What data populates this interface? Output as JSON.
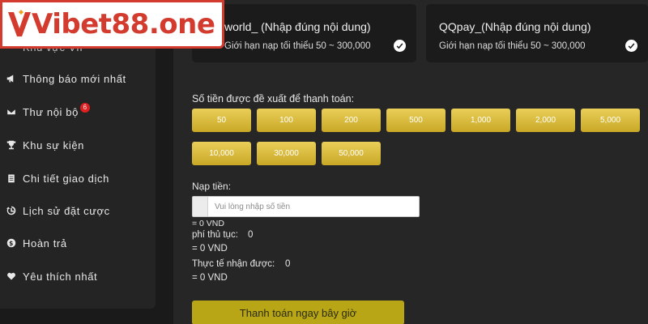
{
  "logo": {
    "text": "Vibet88.one"
  },
  "sidebar": {
    "partial_item": "Khu vực VIP",
    "items": [
      {
        "label": "Thông báo mới nhất",
        "icon": "megaphone-icon"
      },
      {
        "label": "Thư nội bộ",
        "icon": "envelope-icon",
        "badge": "6"
      },
      {
        "label": "Khu sự kiện",
        "icon": "trophy-icon"
      },
      {
        "label": "Chi tiết giao dịch",
        "icon": "clipboard-icon"
      },
      {
        "label": "Lịch sử đặt cược",
        "icon": "history-icon"
      },
      {
        "label": "Hoàn trả",
        "icon": "dollar-icon"
      },
      {
        "label": "Yêu thích nhất",
        "icon": "heart-icon"
      }
    ]
  },
  "payment_methods": [
    {
      "title": "world_  (Nhập đúng nội dung)",
      "limit": "Giới hạn nạp tối thiểu 50 ~ 300,000",
      "selected": true
    },
    {
      "title": "QQpay_(Nhập đúng nội dung)",
      "limit": "Giới hạn nạp tối thiểu 50 ~ 300,000",
      "selected": true
    }
  ],
  "suggested": {
    "label": "Số tiền được đề xuất để thanh toán:",
    "amounts": [
      "50",
      "100",
      "200",
      "500",
      "1,000",
      "2,000",
      "5,000",
      "10,000",
      "30,000",
      "50,000"
    ]
  },
  "deposit": {
    "label": "Nạp tiền:",
    "placeholder": "Vui lòng nhập số tiền",
    "converted": "= 0 VND"
  },
  "fee": {
    "label": "phí thủ tục:",
    "value": "0",
    "converted": "= 0 VND"
  },
  "actual": {
    "label": "Thực tế nhận được:",
    "value": "0",
    "converted": "= 0 VND"
  },
  "pay_button": {
    "label": "Thanh toán ngay bây giờ"
  },
  "colors": {
    "brand_red": "#d23b2e",
    "gold": "#d9bb3a",
    "pay_button": "#b8a616"
  }
}
